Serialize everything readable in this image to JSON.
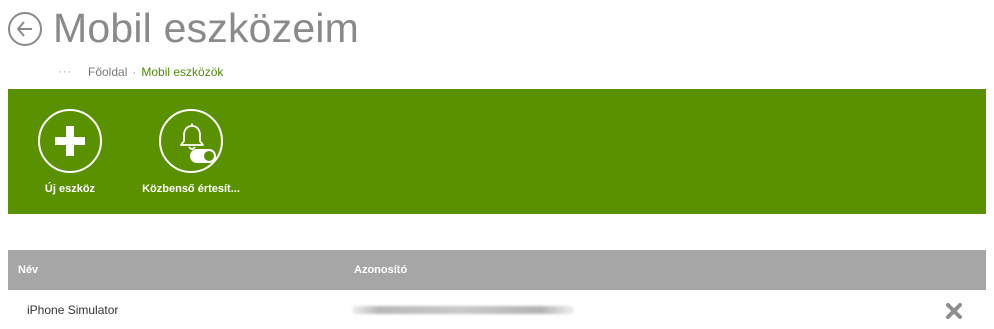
{
  "header": {
    "title": "Mobil eszközeim",
    "back_icon": "arrow-left-circle-icon"
  },
  "breadcrumb": {
    "more": "···",
    "items": [
      {
        "label": "Főoldal"
      },
      {
        "label": "Mobil eszközök"
      }
    ],
    "separator": "·"
  },
  "actions": {
    "background_color": "#5a9100",
    "items": [
      {
        "label": "Új eszköz",
        "icon": "plus-icon"
      },
      {
        "label": "Közbenső értesít...",
        "icon": "bell-toggle-icon"
      }
    ]
  },
  "table": {
    "columns": [
      "Név",
      "Azonosító"
    ],
    "rows": [
      {
        "name": "iPhone Simulator",
        "id": "",
        "delete_icon": "close-icon"
      }
    ]
  },
  "colors": {
    "accent": "#5a9100",
    "header_row": "#a6a6a6",
    "breadcrumb_link": "#4f8a0b"
  }
}
